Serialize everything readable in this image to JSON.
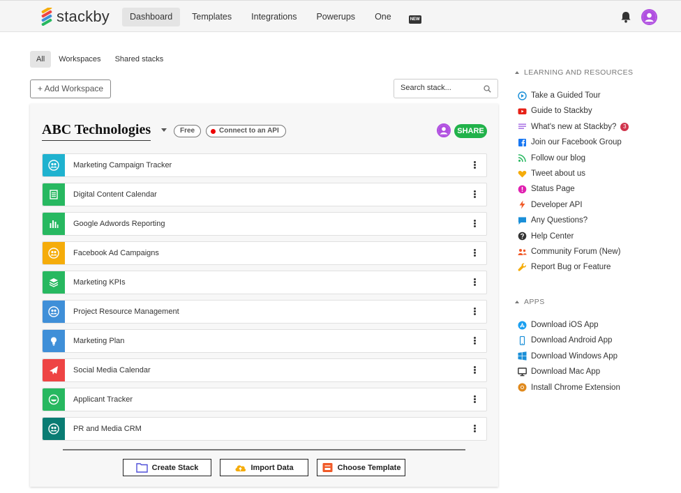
{
  "app": {
    "name": "stackby"
  },
  "nav": {
    "items": [
      {
        "label": "Dashboard",
        "active": true
      },
      {
        "label": "Templates",
        "active": false
      },
      {
        "label": "Integrations",
        "active": false
      },
      {
        "label": "Powerups",
        "active": false
      },
      {
        "label": "One",
        "active": false
      }
    ],
    "new_badge": "NEW"
  },
  "filters": {
    "tabs": [
      {
        "label": "All",
        "active": true
      },
      {
        "label": "Workspaces",
        "active": false
      },
      {
        "label": "Shared stacks",
        "active": false
      }
    ]
  },
  "toolbar": {
    "add_workspace": "+ Add Workspace",
    "search_placeholder": "Search stack..."
  },
  "workspace": {
    "title": "ABC Technologies",
    "plan": "Free",
    "api_label": "Connect to an API",
    "share_label": "SHARE",
    "stacks": [
      {
        "name": "Marketing Campaign Tracker",
        "icon": "people-circle-icon",
        "color": "#1fb2cf"
      },
      {
        "name": "Digital Content Calendar",
        "icon": "document-icon",
        "color": "#27b860"
      },
      {
        "name": "Google Adwords Reporting",
        "icon": "bar-chart-icon",
        "color": "#27b860"
      },
      {
        "name": "Facebook Ad Campaigns",
        "icon": "people-circle-icon",
        "color": "#f5ac0a"
      },
      {
        "name": "Marketing KPIs",
        "icon": "layers-icon",
        "color": "#27b860"
      },
      {
        "name": "Project Resource Management",
        "icon": "people-circle-icon",
        "color": "#3f8fd8"
      },
      {
        "name": "Marketing Plan",
        "icon": "lightbulb-icon",
        "color": "#3f8fd8"
      },
      {
        "name": "Social Media Calendar",
        "icon": "plane-icon",
        "color": "#ee4444"
      },
      {
        "name": "Applicant Tracker",
        "icon": "smile-icon",
        "color": "#27b860"
      },
      {
        "name": "PR and Media CRM",
        "icon": "people-circle-icon",
        "color": "#0a7c73"
      }
    ],
    "actions": {
      "create": "Create Stack",
      "import": "Import Data",
      "template": "Choose Template"
    }
  },
  "sidebar": {
    "learning_title": "LEARNING AND RESOURCES",
    "learning": [
      {
        "label": "Take a Guided Tour",
        "icon": "play-circle-icon",
        "color": "#1a8fd8"
      },
      {
        "label": "Guide to Stackby",
        "icon": "youtube-icon",
        "color": "#e62117"
      },
      {
        "label": "What's new at Stackby?",
        "icon": "list-icon",
        "color": "#9b59e0",
        "badge": "3"
      },
      {
        "label": "Join our Facebook Group",
        "icon": "facebook-icon",
        "color": "#1877f2"
      },
      {
        "label": "Follow our blog",
        "icon": "rss-icon",
        "color": "#27b860"
      },
      {
        "label": "Tweet about us",
        "icon": "heart-icon",
        "color": "#f5ac0a"
      },
      {
        "label": "Status Page",
        "icon": "alert-circle-icon",
        "color": "#e020b0"
      },
      {
        "label": "Developer API",
        "icon": "bolt-icon",
        "color": "#f05a28"
      },
      {
        "label": "Any Questions?",
        "icon": "chat-icon",
        "color": "#1a8fd8"
      },
      {
        "label": "Help Center",
        "icon": "help-icon",
        "color": "#333333"
      },
      {
        "label": "Community Forum (New)",
        "icon": "community-icon",
        "color": "#f05a28"
      },
      {
        "label": "Report Bug or Feature",
        "icon": "wrench-icon",
        "color": "#f5ac0a"
      }
    ],
    "apps_title": "APPS",
    "apps": [
      {
        "label": "Download iOS App",
        "icon": "app-store-icon",
        "color": "#1a9ff0"
      },
      {
        "label": "Download Android App",
        "icon": "phone-icon",
        "color": "#1a8fd8"
      },
      {
        "label": "Download Windows App",
        "icon": "windows-icon",
        "color": "#1a8fd8"
      },
      {
        "label": "Download Mac App",
        "icon": "monitor-icon",
        "color": "#333333"
      },
      {
        "label": "Install Chrome Extension",
        "icon": "chrome-icon",
        "color": "#e08a1e"
      }
    ]
  }
}
